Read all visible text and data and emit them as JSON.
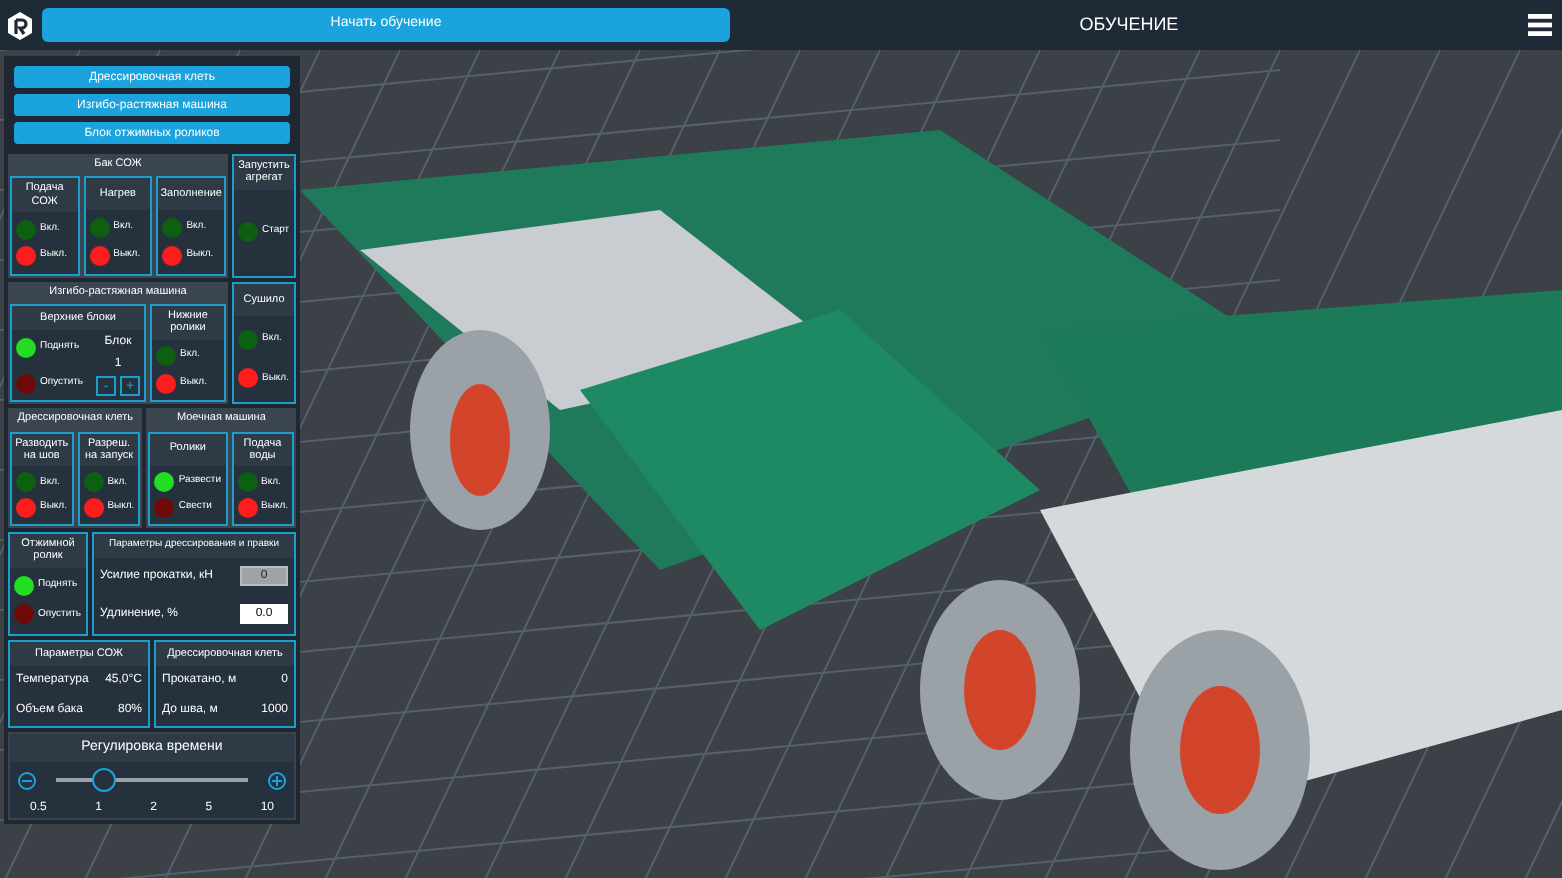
{
  "header": {
    "start_button": "Начать обучение",
    "title": "ОБУЧЕНИЕ"
  },
  "machine_buttons": [
    "Дрессировочная клеть",
    "Изгибо-растяжная машина",
    "Блок отжимных роликов"
  ],
  "tank": {
    "title": "Бак СОЖ",
    "groups": [
      {
        "title": "Подача СОЖ",
        "lamps": [
          {
            "kind": "green",
            "lit": false,
            "label": "Вкл."
          },
          {
            "kind": "red",
            "lit": true,
            "label": "Выкл."
          }
        ]
      },
      {
        "title": "Нагрев",
        "lamps": [
          {
            "kind": "green",
            "lit": false,
            "label": "Вкл."
          },
          {
            "kind": "red",
            "lit": true,
            "label": "Выкл."
          }
        ]
      },
      {
        "title": "Заполнение",
        "lamps": [
          {
            "kind": "green",
            "lit": false,
            "label": "Вкл."
          },
          {
            "kind": "red",
            "lit": true,
            "label": "Выкл."
          }
        ]
      }
    ]
  },
  "launch": {
    "title": "Запустить агрегат",
    "lamps": [
      {
        "kind": "green",
        "lit": false,
        "label": "Старт"
      }
    ]
  },
  "bending": {
    "title": "Изгибо-растяжная машина",
    "upper": {
      "title": "Верхние блоки",
      "lamps": [
        {
          "kind": "green",
          "lit": true,
          "label": "Поднять"
        },
        {
          "kind": "red",
          "lit": false,
          "label": "Опустить"
        }
      ],
      "block_label": "Блок",
      "block_value": "1",
      "minus": "-",
      "plus": "+"
    },
    "groups": [
      {
        "title": "Нижние ролики",
        "lamps": [
          {
            "kind": "green",
            "lit": false,
            "label": "Вкл."
          },
          {
            "kind": "red",
            "lit": true,
            "label": "Выкл."
          }
        ]
      }
    ]
  },
  "dryer": {
    "title": "Сушило",
    "lamps": [
      {
        "kind": "green",
        "lit": false,
        "label": "Вкл."
      },
      {
        "kind": "red",
        "lit": true,
        "label": "Выкл."
      }
    ]
  },
  "stand": {
    "title": "Дрессировочная клеть",
    "groups": [
      {
        "title": "Разводить на шов",
        "lamps": [
          {
            "kind": "green",
            "lit": false,
            "label": "Вкл."
          },
          {
            "kind": "red",
            "lit": true,
            "label": "Выкл."
          }
        ]
      },
      {
        "title": "Разреш. на запуск",
        "lamps": [
          {
            "kind": "green",
            "lit": false,
            "label": "Вкл."
          },
          {
            "kind": "red",
            "lit": true,
            "label": "Выкл."
          }
        ]
      }
    ]
  },
  "washer": {
    "title": "Моечная машина",
    "groups": [
      {
        "title": "Ролики",
        "lamps": [
          {
            "kind": "green",
            "lit": true,
            "label": "Развести"
          },
          {
            "kind": "red",
            "lit": false,
            "label": "Свести"
          }
        ]
      },
      {
        "title": "Подача воды",
        "lamps": [
          {
            "kind": "green",
            "lit": false,
            "label": "Вкл."
          },
          {
            "kind": "red",
            "lit": true,
            "label": "Выкл."
          }
        ]
      }
    ]
  },
  "squeeze": {
    "title": "Отжимной ролик",
    "lamps": [
      {
        "kind": "green",
        "lit": true,
        "label": "Поднять"
      },
      {
        "kind": "red",
        "lit": false,
        "label": "Опустить"
      }
    ]
  },
  "params": {
    "title": "Параметры дрессирования и правки",
    "fields": [
      {
        "label": "Усилие прокатки, кН",
        "value": "0",
        "disabled": true
      },
      {
        "label": "Удлинение, %",
        "value": "0.0",
        "disabled": false
      }
    ]
  },
  "coolant": {
    "title": "Параметры СОЖ",
    "rows": [
      {
        "label": "Температура",
        "value": "45,0°C"
      },
      {
        "label": "Объем бака",
        "value": "80%"
      }
    ]
  },
  "counter": {
    "title": "Дрессировочная клеть",
    "rows": [
      {
        "label": "Прокатано, м",
        "value": "0"
      },
      {
        "label": "До шва, м",
        "value": "1000"
      }
    ]
  },
  "time": {
    "title": "Регулировка времени",
    "level": 0.25,
    "ticks": [
      "0.5",
      "1",
      "2",
      "5",
      "10"
    ]
  }
}
